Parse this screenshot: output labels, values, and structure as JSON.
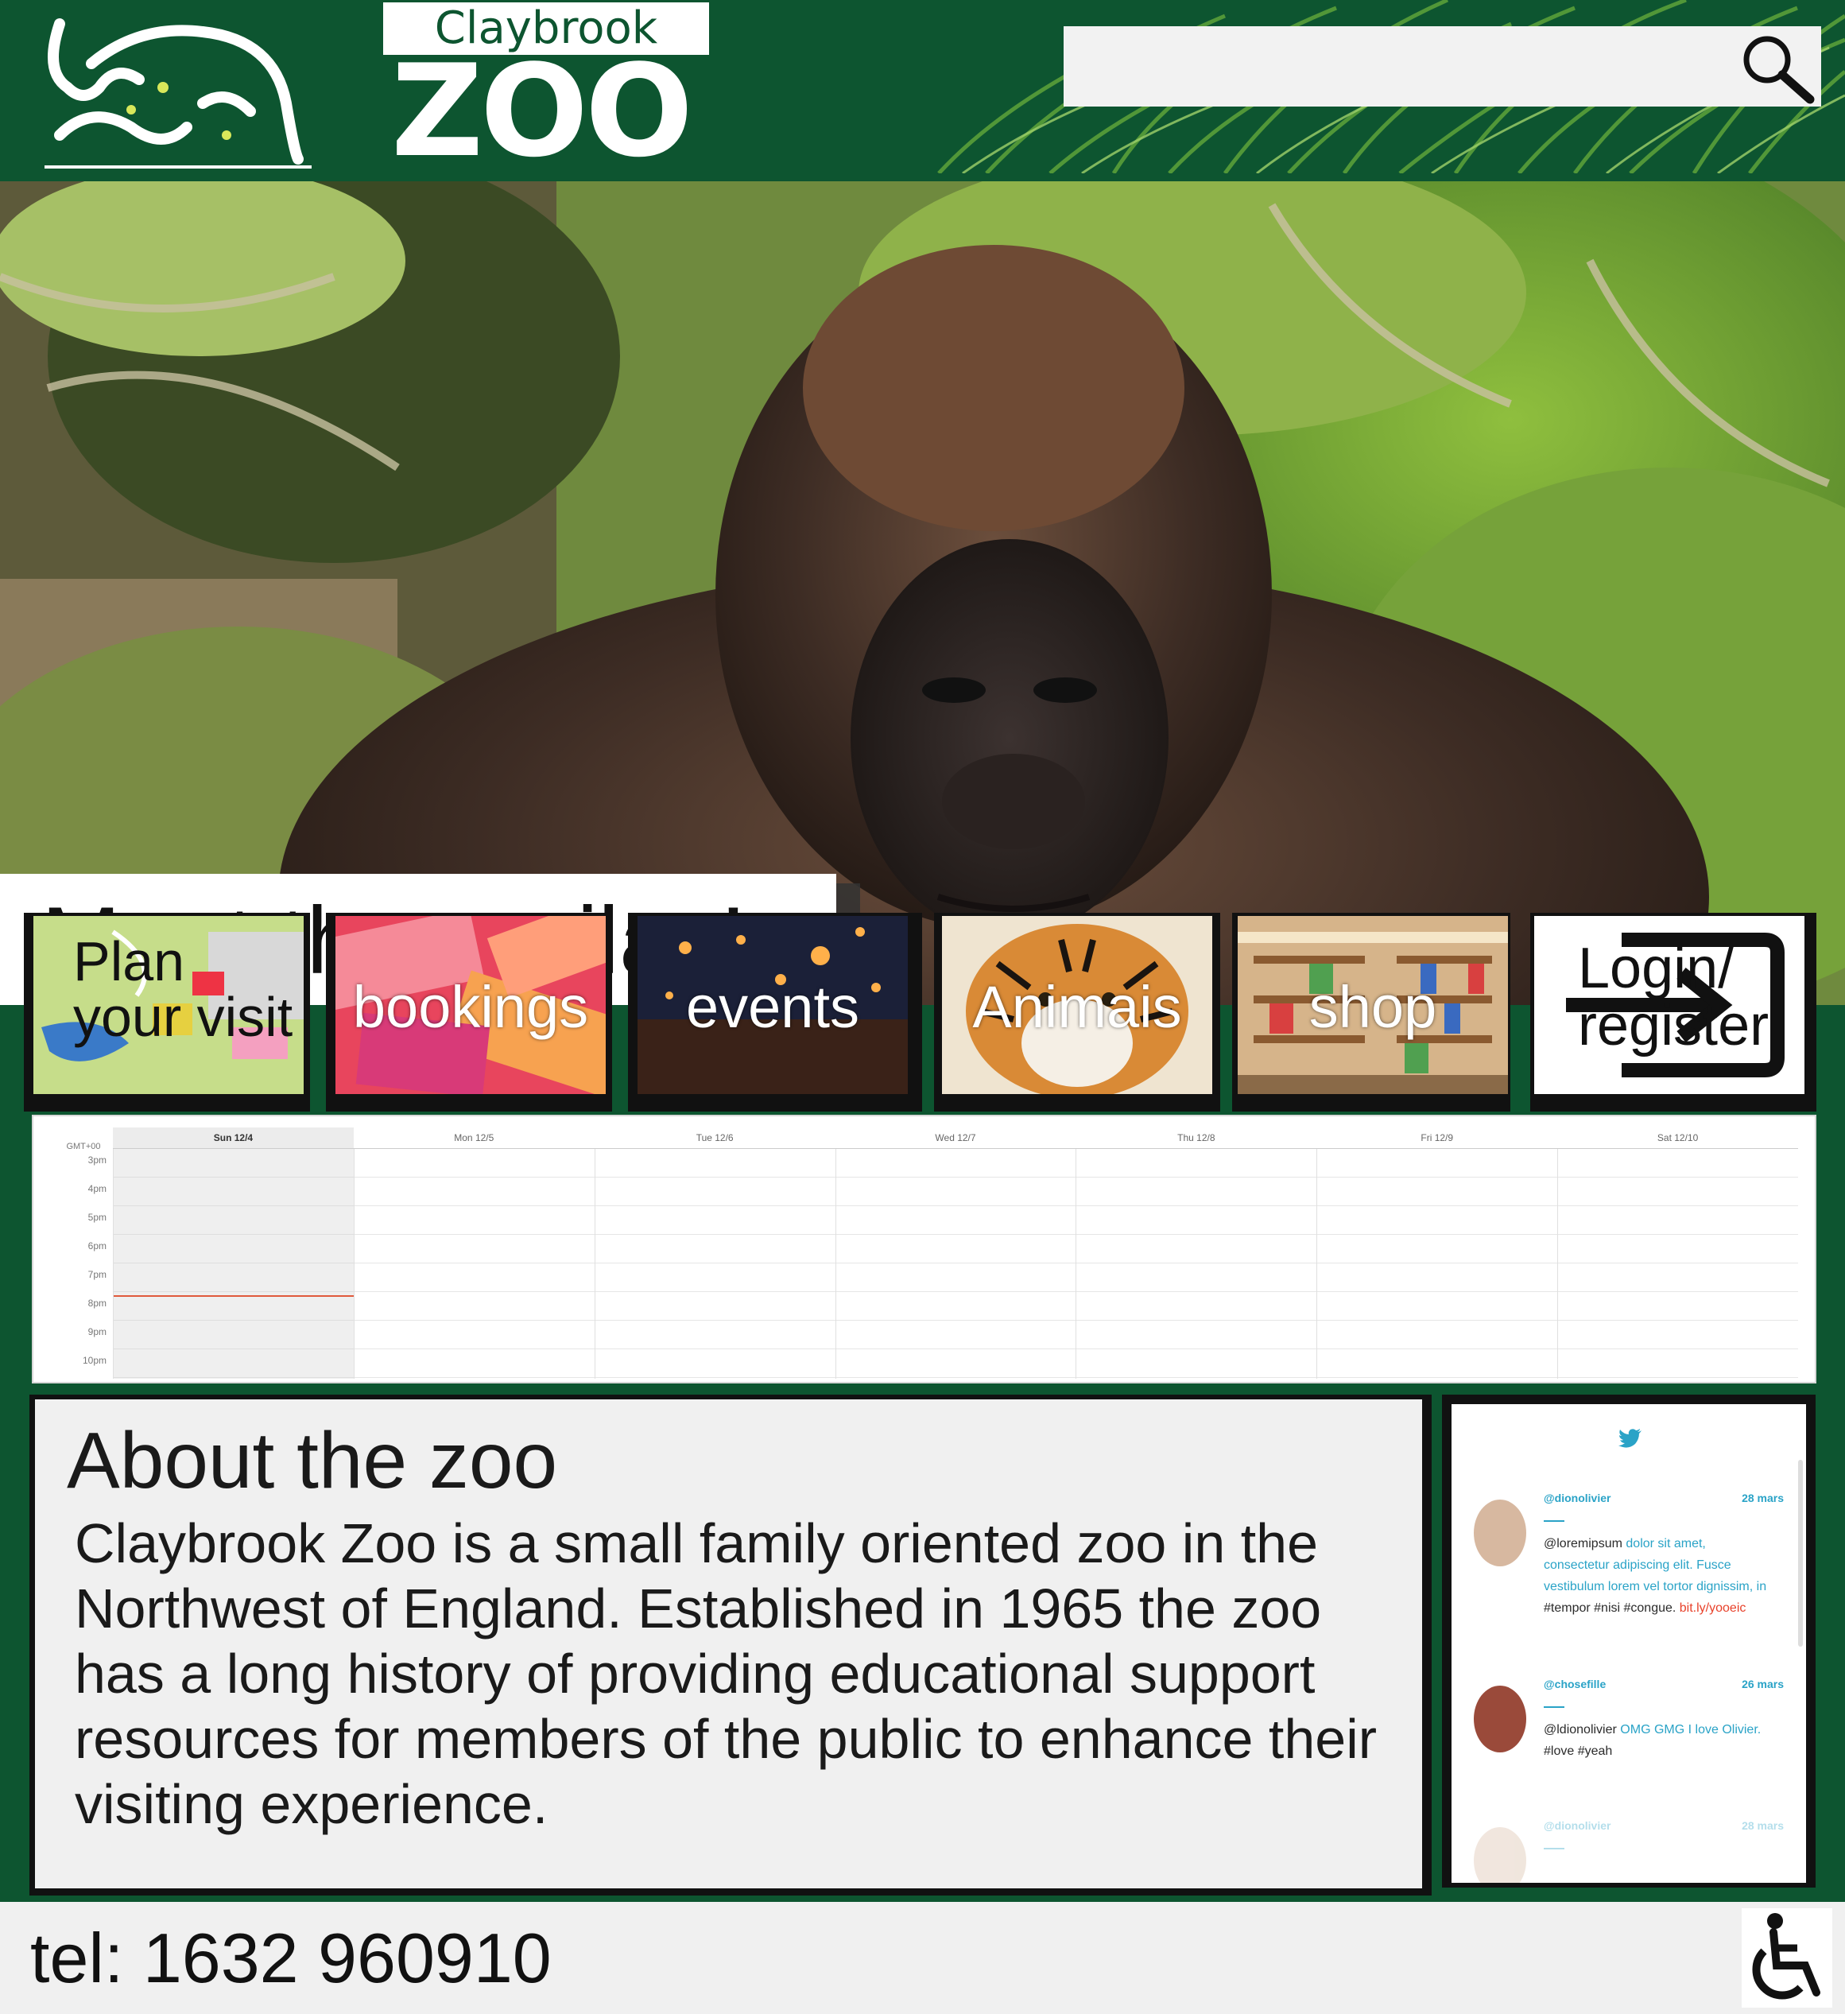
{
  "header": {
    "brand_top": "Claybrook",
    "brand_main": "ZOO",
    "search": {
      "value": "",
      "icon": "search-icon"
    }
  },
  "hero": {
    "caption": "Meet the gorilas!",
    "image": "gorilla-photo"
  },
  "nav": [
    {
      "label": "Plan your visit",
      "image": "zoo-map"
    },
    {
      "label": "bookings",
      "image": "tickets"
    },
    {
      "label": "events",
      "image": "lanterns-crowd"
    },
    {
      "label": "Animais",
      "image": "tiger"
    },
    {
      "label": "shop",
      "image": "shop-shelves"
    },
    {
      "label": "Login/ register",
      "icon": "login-icon"
    }
  ],
  "calendar": {
    "timezone": "GMT+00",
    "days": [
      "Sun 12/4",
      "Mon 12/5",
      "Tue 12/6",
      "Wed 12/7",
      "Thu 12/8",
      "Fri 12/9",
      "Sat 12/10"
    ],
    "times": [
      "3pm",
      "4pm",
      "5pm",
      "6pm",
      "7pm",
      "8pm",
      "9pm",
      "10pm"
    ]
  },
  "about": {
    "title": "About the zoo",
    "text": "Claybrook Zoo is a small family oriented zoo in the Northwest of England. Established in 1965 the zoo has a long history of providing educational support resources for members of the public to enhance their visiting experience."
  },
  "twitter": {
    "icon": "twitter-bird-icon",
    "tweets": [
      {
        "handle": "@dionolivier",
        "date": "28 mars",
        "prefix": "@loremipsum",
        "link_text": "dolor sit amet, consectetur adipiscing elit. Fusce vestibulum lorem vel tortor dignissim, in",
        "tags": "#tempor #nisi #congue.",
        "url": "bit.ly/yooeic"
      },
      {
        "handle": "@chosefille",
        "date": "26 mars",
        "prefix": "@ldionolivier",
        "link_text": "OMG GMG I love Olivier.",
        "tags": "#love #yeah",
        "url": ""
      },
      {
        "handle": "@dionolivier",
        "date": "28 mars"
      }
    ]
  },
  "footer": {
    "tel": "tel: 1632 960910",
    "accessibility_icon": "wheelchair-icon"
  },
  "colors": {
    "brand_green": "#0d5530",
    "panel": "#f0f0f0",
    "twitter": "#2aa3c7"
  }
}
